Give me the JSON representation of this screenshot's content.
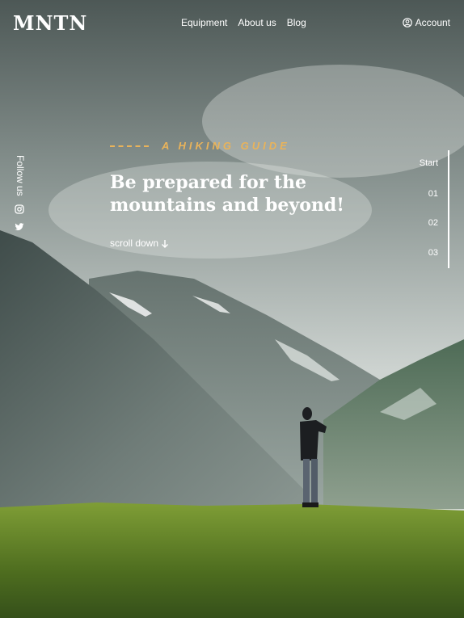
{
  "header": {
    "logo": "MNTN",
    "nav": [
      "Equipment",
      "About us",
      "Blog"
    ],
    "account_label": "Account",
    "account_icon": "user-circle-icon"
  },
  "sidebar": {
    "follow_label": "Follow us",
    "social": [
      "instagram-icon",
      "twitter-icon"
    ]
  },
  "hero": {
    "tagline": "A HIKING GUIDE",
    "headline_line1": "Be prepared for the",
    "headline_line2": "mountains and beyond!",
    "scroll_label": "scroll down",
    "scroll_icon": "arrow-down-icon"
  },
  "steps": [
    "Start",
    "01",
    "02",
    "03"
  ],
  "colors": {
    "accent": "#e9b35a"
  }
}
